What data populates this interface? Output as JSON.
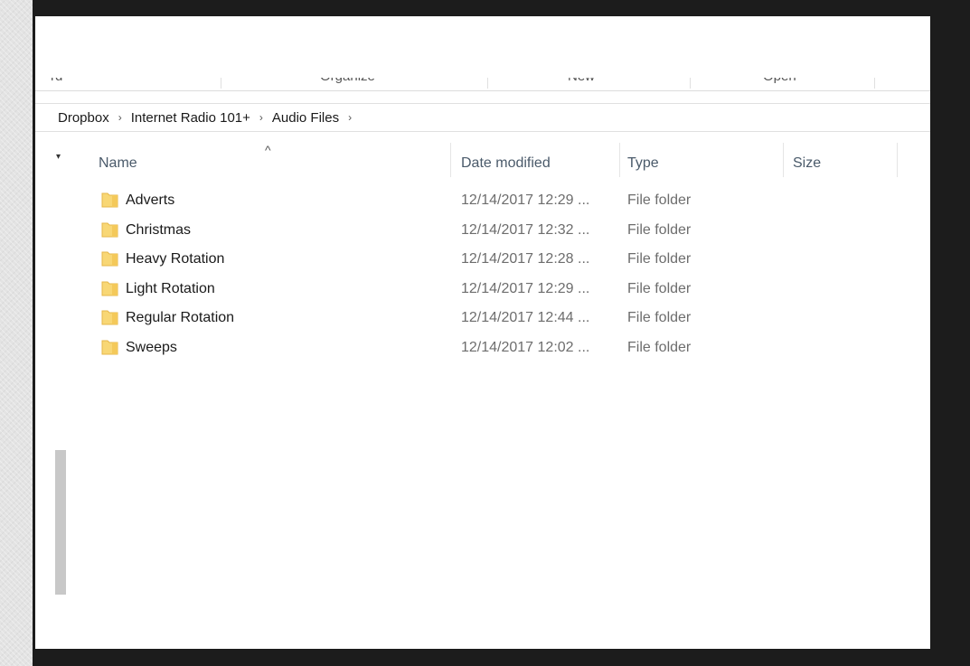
{
  "ribbon": {
    "groups": [
      "rd",
      "Organize",
      "New",
      "Open"
    ]
  },
  "breadcrumb": {
    "items": [
      "Dropbox",
      "Internet Radio 101+",
      "Audio Files"
    ],
    "separator": "›"
  },
  "columns": {
    "sort_indicator": "^",
    "name": "Name",
    "date_modified": "Date modified",
    "type": "Type",
    "size": "Size"
  },
  "folders": [
    {
      "name": "Adverts",
      "date": "12/14/2017 12:29 ...",
      "type": "File folder"
    },
    {
      "name": "Christmas",
      "date": "12/14/2017 12:32 ...",
      "type": "File folder"
    },
    {
      "name": "Heavy Rotation",
      "date": "12/14/2017 12:28 ...",
      "type": "File folder"
    },
    {
      "name": "Light Rotation",
      "date": "12/14/2017 12:29 ...",
      "type": "File folder"
    },
    {
      "name": "Regular Rotation",
      "date": "12/14/2017 12:44 ...",
      "type": "File folder"
    },
    {
      "name": "Sweeps",
      "date": "12/14/2017 12:02 ...",
      "type": "File folder"
    }
  ],
  "colors": {
    "folder_yellow": "#f8d775",
    "folder_shadow": "#e6b74a",
    "frame": "#1c1c1c"
  },
  "icons": {
    "folder": "folder-icon",
    "sort": "sort-ascending-icon",
    "chevron": "chevron-right-icon"
  }
}
